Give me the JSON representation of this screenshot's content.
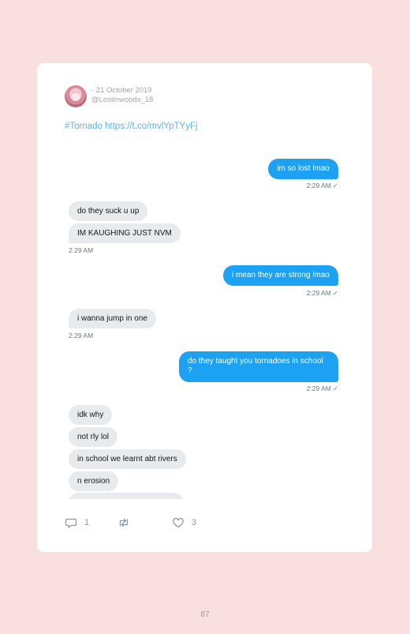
{
  "tweet": {
    "date": "· 21 October 2019",
    "handle": "@Lostinwoods_18",
    "text": "#Tornado https://t.co/mvlYpTYyFj"
  },
  "messages": [
    {
      "dir": "out",
      "text": "im so lost lmao"
    },
    {
      "dir": "out_time",
      "text": "2:29 AM"
    },
    {
      "dir": "in",
      "text": "do they suck u up"
    },
    {
      "dir": "in",
      "text": "IM KAUGHING JUST NVM"
    },
    {
      "dir": "in_time",
      "text": "2:29 AM"
    },
    {
      "dir": "out",
      "text": "i mean they are strong lmao"
    },
    {
      "dir": "out_time",
      "text": "2:29 AM"
    },
    {
      "dir": "in",
      "text": "i wanna jump in one"
    },
    {
      "dir": "in_time",
      "text": "2:29 AM"
    },
    {
      "dir": "out",
      "text": "do they taught you tornadoes in school ?"
    },
    {
      "dir": "out_time",
      "text": "2:29 AM"
    },
    {
      "dir": "in",
      "text": "idk why"
    },
    {
      "dir": "in",
      "text": "not rly lol"
    },
    {
      "dir": "in",
      "text": "in school we learnt abt rivers"
    },
    {
      "dir": "in",
      "text": "n erosion"
    }
  ],
  "read_mark": "✓",
  "actions": {
    "reply_count": "1",
    "retweet_count": "",
    "like_count": "3"
  },
  "page_number": "87"
}
